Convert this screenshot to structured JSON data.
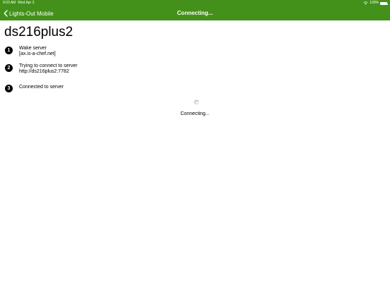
{
  "status_bar": {
    "time": "9:03 AM",
    "date": "Wed Apr 3",
    "battery_percent": "100%",
    "battery_level": 1.0,
    "icons": [
      "wifi-icon",
      "battery-icon"
    ]
  },
  "nav": {
    "back_label": "Lights-Out Mobile",
    "back_icon": "chevron-left-icon",
    "title": "Connecting..."
  },
  "server": {
    "name": "ds216plus2"
  },
  "steps": [
    {
      "number": "1",
      "line1": "Wake server",
      "line2": "[ax.is-a-chef.net]"
    },
    {
      "number": "2",
      "line1": "Trying to connect to server",
      "line2": "http://ds216plus2:7782"
    },
    {
      "number": "3",
      "line1": "Connected to server",
      "line2": ""
    }
  ],
  "loading": {
    "label": "Connecting..."
  },
  "colors": {
    "header_bg": "#43911b",
    "header_text": "#ffffff",
    "body_text": "#000000",
    "spinner": "#8e8e93"
  }
}
